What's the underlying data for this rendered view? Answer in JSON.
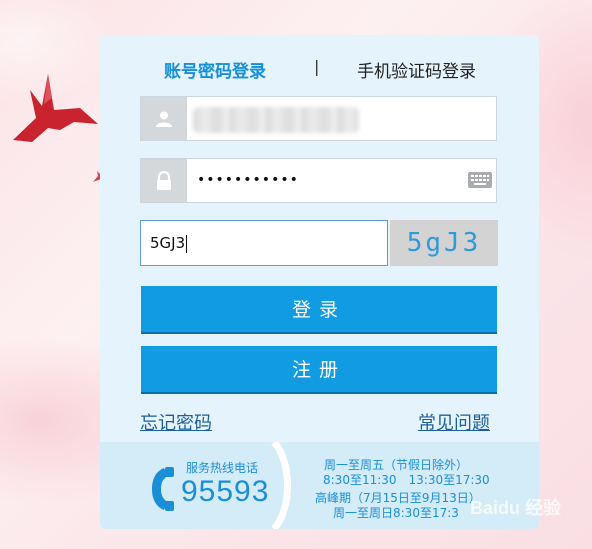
{
  "tabs": {
    "account_password": "账号密码登录",
    "separator": "|",
    "phone_code": "手机验证码登录"
  },
  "form": {
    "password_mask": "•••••••••••",
    "captcha_value": "5GJ3",
    "captcha_image_text": "5gJ3"
  },
  "buttons": {
    "login": "登录",
    "register": "注册"
  },
  "links": {
    "forgot_password": "忘记密码",
    "faq": "常见问题"
  },
  "hotline": {
    "label": "服务热线电话",
    "number": "95593",
    "line1": "周一至周五（节假日除外）",
    "line2": "8:30至11:30　13:30至17:30",
    "line3": "高峰期（7月15日至9月13日）",
    "line4": "周一至周日8:30至17:3"
  },
  "watermark": "Baidu 经验",
  "colors": {
    "accent": "#119be2",
    "tab_active": "#1590db",
    "panel_bg": "#e4f3fc"
  },
  "icons": [
    "user-icon",
    "lock-icon",
    "keyboard-icon",
    "phone-icon",
    "bird-icon"
  ]
}
